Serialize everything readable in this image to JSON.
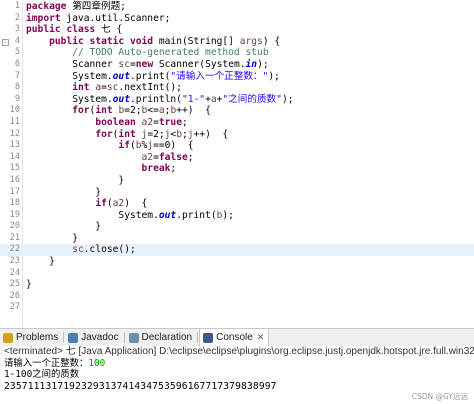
{
  "editor": {
    "lines": [
      {
        "n": "1",
        "segs": [
          [
            "kw",
            "package"
          ],
          [
            "cn",
            " 第四章例题;"
          ]
        ]
      },
      {
        "n": "2",
        "segs": [
          [
            "kw",
            "import"
          ],
          [
            "cn",
            " java.util.Scanner;"
          ]
        ]
      },
      {
        "n": "3",
        "segs": [
          [
            "kw",
            "public"
          ],
          [
            "cn",
            " "
          ],
          [
            "kw",
            "class"
          ],
          [
            "cn",
            " 七 {"
          ]
        ]
      },
      {
        "n": "4",
        "segs": [
          [
            "cn",
            "    "
          ],
          [
            "kw",
            "public"
          ],
          [
            "cn",
            " "
          ],
          [
            "kw",
            "static"
          ],
          [
            "cn",
            " "
          ],
          [
            "kw",
            "void"
          ],
          [
            "cn",
            " main(String[] "
          ],
          [
            "vr",
            "args"
          ],
          [
            "cn",
            ") {"
          ]
        ],
        "fold": "-"
      },
      {
        "n": "5",
        "segs": [
          [
            "cm",
            "        // TODO Auto-generated method stub"
          ]
        ]
      },
      {
        "n": "6",
        "segs": [
          [
            "cn",
            "        Scanner "
          ],
          [
            "vr",
            "sc"
          ],
          [
            "cn",
            "="
          ],
          [
            "kw",
            "new"
          ],
          [
            "cn",
            " Scanner(System."
          ],
          [
            "fld",
            "in"
          ],
          [
            "cn",
            ");"
          ]
        ]
      },
      {
        "n": "7",
        "segs": [
          [
            "cn",
            "        System."
          ],
          [
            "fld",
            "out"
          ],
          [
            "cn",
            ".print("
          ],
          [
            "st",
            "\"请输入一个正整数：\""
          ],
          [
            "cn",
            ");"
          ]
        ]
      },
      {
        "n": "8",
        "segs": [
          [
            "cn",
            "        "
          ],
          [
            "kw",
            "int"
          ],
          [
            "cn",
            " "
          ],
          [
            "vr",
            "a"
          ],
          [
            "cn",
            "="
          ],
          [
            "vr",
            "sc"
          ],
          [
            "cn",
            ".nextInt();"
          ]
        ]
      },
      {
        "n": "9",
        "segs": [
          [
            "cn",
            "        System."
          ],
          [
            "fld",
            "out"
          ],
          [
            "cn",
            ".println("
          ],
          [
            "st",
            "\"1-\""
          ],
          [
            "cn",
            "+"
          ],
          [
            "vr",
            "a"
          ],
          [
            "cn",
            "+"
          ],
          [
            "st",
            "\"之间的质数\""
          ],
          [
            "cn",
            ");"
          ]
        ]
      },
      {
        "n": "10",
        "segs": [
          [
            "cn",
            "        "
          ],
          [
            "kw",
            "for"
          ],
          [
            "cn",
            "("
          ],
          [
            "kw",
            "int"
          ],
          [
            "cn",
            " "
          ],
          [
            "vr",
            "b"
          ],
          [
            "cn",
            "=2;"
          ],
          [
            "vr",
            "b"
          ],
          [
            "cn",
            "<="
          ],
          [
            "vr",
            "a"
          ],
          [
            "cn",
            ";"
          ],
          [
            "vr",
            "b"
          ],
          [
            "cn",
            "++)  {"
          ]
        ]
      },
      {
        "n": "11",
        "segs": [
          [
            "cn",
            "            "
          ],
          [
            "kw",
            "boolean"
          ],
          [
            "cn",
            " "
          ],
          [
            "vr",
            "a2"
          ],
          [
            "cn",
            "="
          ],
          [
            "kw",
            "true"
          ],
          [
            "cn",
            ";"
          ]
        ]
      },
      {
        "n": "12",
        "segs": [
          [
            "cn",
            "            "
          ],
          [
            "kw",
            "for"
          ],
          [
            "cn",
            "("
          ],
          [
            "kw",
            "int"
          ],
          [
            "cn",
            " "
          ],
          [
            "vr",
            "j"
          ],
          [
            "cn",
            "=2;"
          ],
          [
            "vr",
            "j"
          ],
          [
            "cn",
            "<"
          ],
          [
            "vr",
            "b"
          ],
          [
            "cn",
            ";"
          ],
          [
            "vr",
            "j"
          ],
          [
            "cn",
            "++)  {"
          ]
        ]
      },
      {
        "n": "13",
        "segs": [
          [
            "cn",
            "                "
          ],
          [
            "kw",
            "if"
          ],
          [
            "cn",
            "("
          ],
          [
            "vr",
            "b"
          ],
          [
            "cn",
            "%"
          ],
          [
            "vr",
            "j"
          ],
          [
            "cn",
            "==0)  {"
          ]
        ]
      },
      {
        "n": "14",
        "segs": [
          [
            "cn",
            "                    "
          ],
          [
            "vr",
            "a2"
          ],
          [
            "cn",
            "="
          ],
          [
            "kw",
            "false"
          ],
          [
            "cn",
            ";"
          ]
        ]
      },
      {
        "n": "15",
        "segs": [
          [
            "cn",
            "                    "
          ],
          [
            "kw",
            "break"
          ],
          [
            "cn",
            ";"
          ]
        ]
      },
      {
        "n": "16",
        "segs": [
          [
            "cn",
            "                }"
          ]
        ]
      },
      {
        "n": "17",
        "segs": [
          [
            "cn",
            "            }"
          ]
        ]
      },
      {
        "n": "18",
        "segs": [
          [
            "cn",
            "            "
          ],
          [
            "kw",
            "if"
          ],
          [
            "cn",
            "("
          ],
          [
            "vr",
            "a2"
          ],
          [
            "cn",
            ")  {"
          ]
        ]
      },
      {
        "n": "19",
        "segs": [
          [
            "cn",
            "                System."
          ],
          [
            "fld",
            "out"
          ],
          [
            "cn",
            ".print("
          ],
          [
            "vr",
            "b"
          ],
          [
            "cn",
            ");"
          ]
        ]
      },
      {
        "n": "20",
        "segs": [
          [
            "cn",
            "            }"
          ]
        ]
      },
      {
        "n": "21",
        "segs": [
          [
            "cn",
            "        }"
          ]
        ]
      },
      {
        "n": "22",
        "segs": [
          [
            "cn",
            "        "
          ],
          [
            "vr",
            "sc"
          ],
          [
            "cn",
            ".close();"
          ]
        ],
        "hl": true
      },
      {
        "n": "23",
        "segs": [
          [
            "cn",
            "    }"
          ]
        ]
      },
      {
        "n": "24",
        "segs": [
          [
            "cn",
            ""
          ]
        ]
      },
      {
        "n": "25",
        "segs": [
          [
            "cn",
            "}"
          ]
        ]
      },
      {
        "n": "26",
        "segs": [
          [
            "cn",
            ""
          ]
        ]
      },
      {
        "n": "27",
        "segs": [
          [
            "cn",
            ""
          ]
        ]
      }
    ]
  },
  "console_tabs": [
    {
      "label": "Problems",
      "icon_name": "problems-icon",
      "color": "#d4a017",
      "active": false
    },
    {
      "label": "Javadoc",
      "icon_name": "javadoc-icon",
      "color": "#4a7fb5",
      "active": false
    },
    {
      "label": "Declaration",
      "icon_name": "declaration-icon",
      "color": "#6f8fa8",
      "active": false
    },
    {
      "label": "Console",
      "icon_name": "console-icon",
      "color": "#3a5a8a",
      "active": true,
      "close": "✕"
    }
  ],
  "console": {
    "status": "<terminated> 七 [Java Application] D:\\eclipse\\eclipse\\plugins\\org.eclipse.justj.openjdk.hotspot.jre.full.win32.x86",
    "prompt": "请输入一个正整数：",
    "input": "100",
    "header": "1-100之间的质数",
    "output": "2357111317192329313741434753596167717379838997"
  },
  "watermark": "CSDN @GY远远"
}
